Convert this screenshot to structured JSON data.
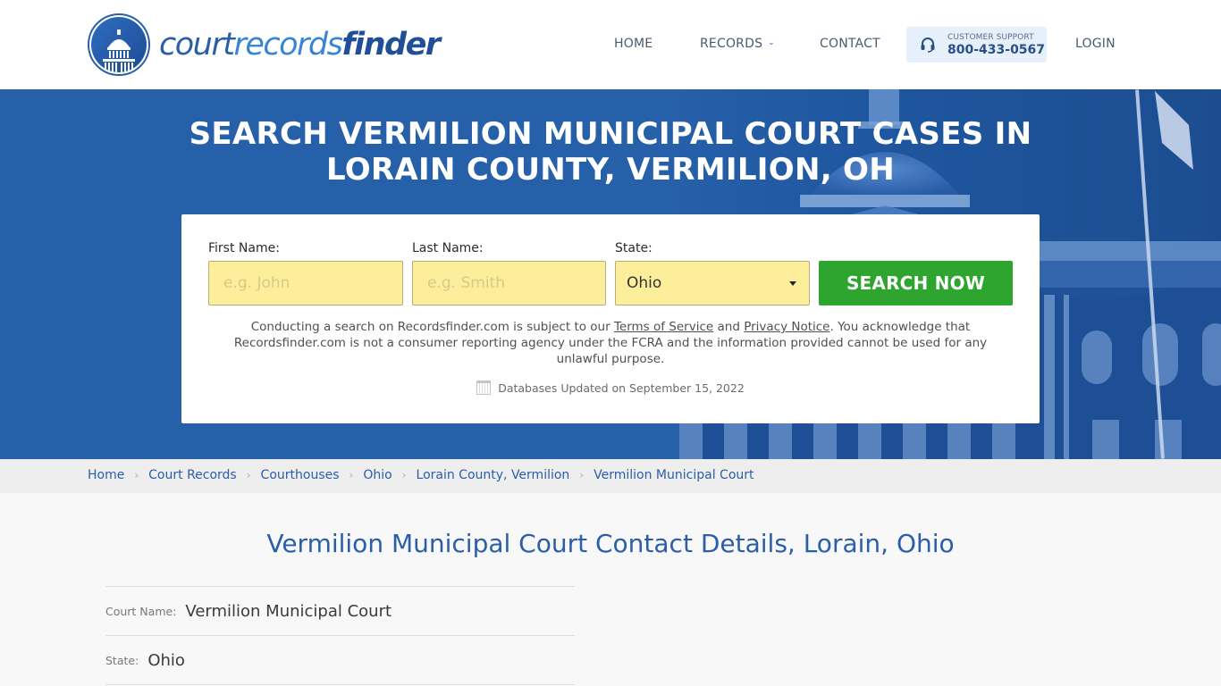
{
  "brand": {
    "logo_part1": "court",
    "logo_part2": "records",
    "logo_part3": "finder",
    "primary_color": "#2a5ea8",
    "accent_green": "#2ea52f",
    "input_yellow": "#fdee9c"
  },
  "nav": {
    "home": "HOME",
    "records": "RECORDS",
    "contact": "CONTACT",
    "support_label": "CUSTOMER SUPPORT",
    "support_phone": "800-433-0567",
    "login": "LOGIN"
  },
  "hero": {
    "title": "SEARCH VERMILION MUNICIPAL COURT CASES IN LORAIN COUNTY, VERMILION, OH"
  },
  "search": {
    "first_name_label": "First Name:",
    "first_name_placeholder": "e.g. John",
    "first_name_value": "",
    "last_name_label": "Last Name:",
    "last_name_placeholder": "e.g. Smith",
    "last_name_value": "",
    "state_label": "State:",
    "state_value": "Ohio",
    "button_label": "SEARCH NOW",
    "disclaimer_pre": "Conducting a search on Recordsfinder.com is subject to our ",
    "terms_link": "Terms of Service",
    "disclaimer_and": " and ",
    "privacy_link": "Privacy Notice",
    "disclaimer_post": ". You acknowledge that Recordsfinder.com is not a consumer reporting agency under the FCRA and the information provided cannot be used for any unlawful purpose.",
    "db_updated": "Databases Updated on September 15, 2022"
  },
  "breadcrumb": [
    {
      "label": "Home"
    },
    {
      "label": "Court Records"
    },
    {
      "label": "Courthouses"
    },
    {
      "label": "Ohio"
    },
    {
      "label": "Lorain County, Vermilion"
    },
    {
      "label": "Vermilion Municipal Court"
    }
  ],
  "main": {
    "title": "Vermilion Municipal Court Contact Details, Lorain, Ohio",
    "details": [
      {
        "label": "Court Name:",
        "value": "Vermilion Municipal Court"
      },
      {
        "label": "State:",
        "value": "Ohio"
      }
    ]
  }
}
